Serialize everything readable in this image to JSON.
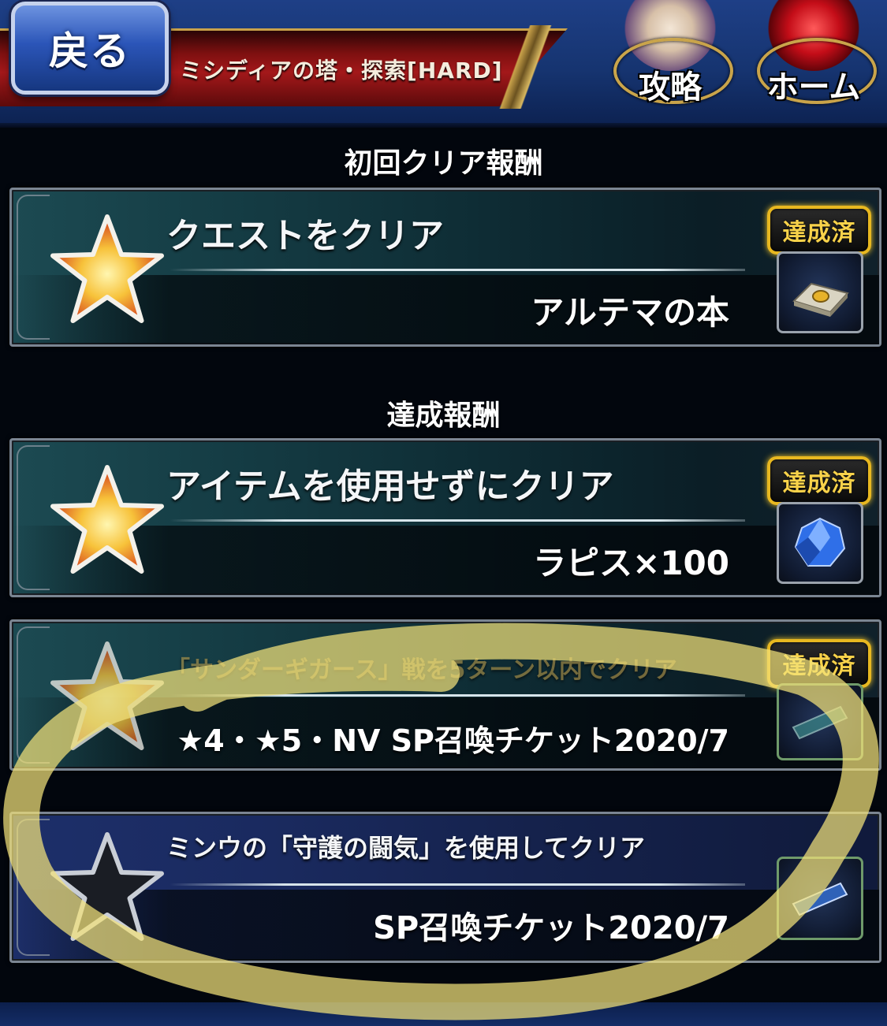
{
  "header": {
    "back_label": "戻る",
    "page_title": "ミシディアの塔・探索[HARD]",
    "strategy_label": "攻略",
    "home_label": "ホーム"
  },
  "sections": {
    "first_clear_heading": "初回クリア報酬",
    "achievement_heading": "達成報酬"
  },
  "missions": [
    {
      "title": "クエストをクリア",
      "reward": "アルテマの本",
      "badge": "達成済",
      "star": "gold",
      "reward_icon": "book-icon"
    },
    {
      "title": "アイテムを使用せずにクリア",
      "reward": "ラピス×100",
      "badge": "達成済",
      "star": "gold",
      "reward_icon": "lapis-crystal-icon"
    },
    {
      "title": "「サンダーギガース」戦を5ターン以内でクリア",
      "reward": "★4・★5・NV SP召喚チケット2020/7",
      "badge": "達成済",
      "star": "gold",
      "reward_icon": "special-ticket-icon"
    },
    {
      "title": "ミンウの「守護の闘気」を使用してクリア",
      "reward": "SP召喚チケット2020/7",
      "badge": "",
      "star": "black",
      "reward_icon": "special-ticket-icon"
    }
  ],
  "colors": {
    "header_blue": "#163470",
    "banner_red": "#a3181a",
    "badge_gold": "#e8b820",
    "highlighter_yellow": "#f3e27a"
  }
}
